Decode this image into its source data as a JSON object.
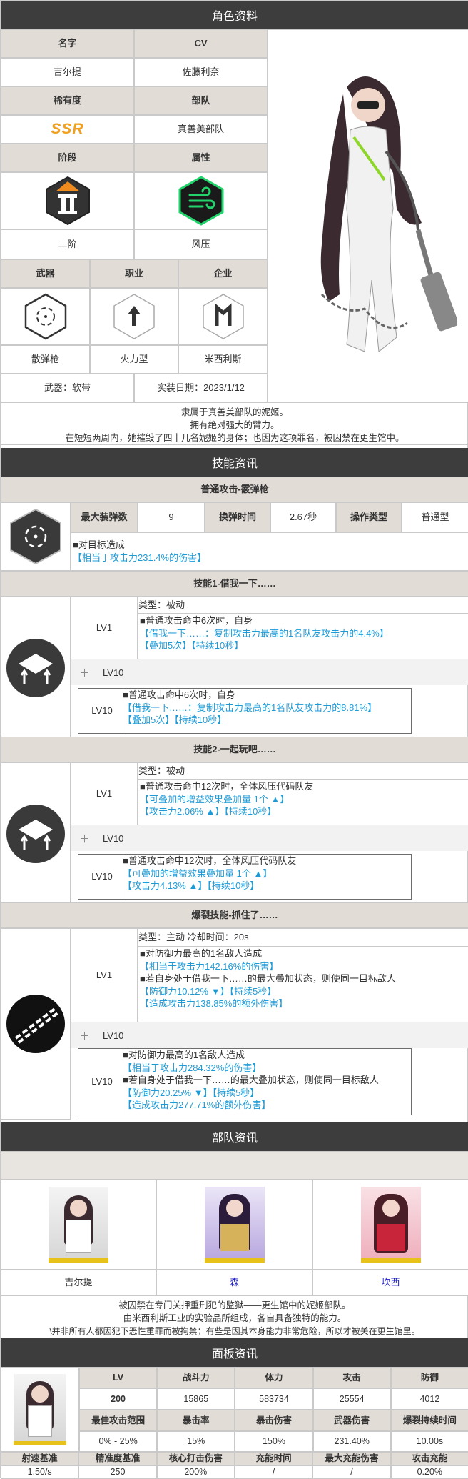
{
  "profile": {
    "title": "角色资料",
    "name_h": "名字",
    "cv_h": "CV",
    "name": "吉尔提",
    "cv": "佐藤利奈",
    "rarity_h": "稀有度",
    "squad_h": "部队",
    "rarity": "SSR",
    "squad": "真善美部队",
    "stage_h": "阶段",
    "attr_h": "属性",
    "stage": "二阶",
    "attr": "风压",
    "weapon_h": "武器",
    "job_h": "职业",
    "corp_h": "企业",
    "weapon": "散弹枪",
    "job": "火力型",
    "corp": "米西利斯",
    "arm": "武器：软带",
    "date": "实装日期：2023/1/12",
    "desc": [
      "隶属于真善美部队的妮姬。",
      "拥有绝对强大的臂力。",
      "在短短两周内，她摧毁了四十几名妮姬的身体；也因为这项罪名，被囚禁在更生馆中。"
    ]
  },
  "skills": {
    "title": "技能资讯",
    "normal": {
      "name": "普通攻击-霰弹枪",
      "ammo_h": "最大装弹数",
      "ammo": "9",
      "reload_h": "换弹时间",
      "reload": "2.67秒",
      "op_h": "操作类型",
      "op": "普通型",
      "l1": "■对目标造成",
      "l2": "【相当于攻击力231.4%的伤害】"
    },
    "s1": {
      "name": "技能1-借我一下……",
      "type": "类型：被动",
      "lv1": "LV1",
      "lv10": "LV10",
      "a1": "■普通攻击命中6次时，自身",
      "a2": "【借我一下……：复制攻击力最高的1名队友攻击力的4.4%】",
      "a3": "【叠加5次】【持续10秒】",
      "b1": "■普通攻击命中6次时，自身",
      "b2": "【借我一下……：复制攻击力最高的1名队友攻击力的8.81%】",
      "b3": "【叠加5次】【持续10秒】"
    },
    "s2": {
      "name": "技能2-一起玩吧……",
      "type": "类型：被动",
      "lv1": "LV1",
      "lv10": "LV10",
      "a1": "■普通攻击命中12次时，全体风压代码队友",
      "a2": "【可叠加的增益效果叠加量 1个 ▲】",
      "a3": "【攻击力2.06% ▲】【持续10秒】",
      "b1": "■普通攻击命中12次时，全体风压代码队友",
      "b2": "【可叠加的增益效果叠加量 1个 ▲】",
      "b3": "【攻击力4.13% ▲】【持续10秒】"
    },
    "burst": {
      "name": "爆裂技能-抓住了……",
      "type": "类型：主动 冷却时间：20s",
      "lv1": "LV1",
      "lv10": "LV10",
      "a1": "■对防御力最高的1名敌人造成",
      "a2": "【相当于攻击力142.16%的伤害】",
      "a3": "■若自身处于借我一下……的最大叠加状态，则使同一目标敌人",
      "a4": "【防御力10.12% ▼】【持续5秒】",
      "a5": "【造成攻击力138.85%的额外伤害】",
      "b1": "■对防御力最高的1名敌人造成",
      "b2": "【相当于攻击力284.32%的伤害】",
      "b3": "■若自身处于借我一下……的最大叠加状态，则使同一目标敌人",
      "b4": "【防御力20.25% ▼】【持续5秒】",
      "b5": "【造成攻击力277.71%的额外伤害】"
    }
  },
  "team": {
    "title": "部队资讯",
    "members": [
      "吉尔提",
      "森",
      "坎西"
    ],
    "desc": [
      "被囚禁在专门关押重刑犯的监狱——更生馆中的妮姬部队。",
      "由米西利斯工业的实验品所组成，各自具备独特的能力。",
      "\\并非所有人都因犯下恶性重罪而被拘禁；有些是因其本身能力非常危险，所以才被关在更生馆里。"
    ]
  },
  "panel": {
    "title": "面板资讯",
    "h1": [
      "LV",
      "战斗力",
      "体力",
      "攻击",
      "防御"
    ],
    "v1": [
      "200",
      "15865",
      "583734",
      "25554",
      "4012"
    ],
    "h2": [
      "最佳攻击范围",
      "暴击率",
      "暴击伤害",
      "武器伤害",
      "爆裂持续时间"
    ],
    "v2": [
      "0% - 25%",
      "15%",
      "150%",
      "231.40%",
      "10.00s"
    ],
    "h3": [
      "射速基准",
      "精准度基准",
      "核心打击伤害",
      "充能时间",
      "最大充能伤害",
      "攻击充能"
    ],
    "v3": [
      "1.50/s",
      "250",
      "200%",
      "/",
      "/",
      "0.20%"
    ]
  },
  "colors": {
    "band": "#3d3d3d",
    "header": "#e2dcd6",
    "blue": "#1e9bd7",
    "wind": "#22d36b",
    "rarity": "#f0a020"
  }
}
